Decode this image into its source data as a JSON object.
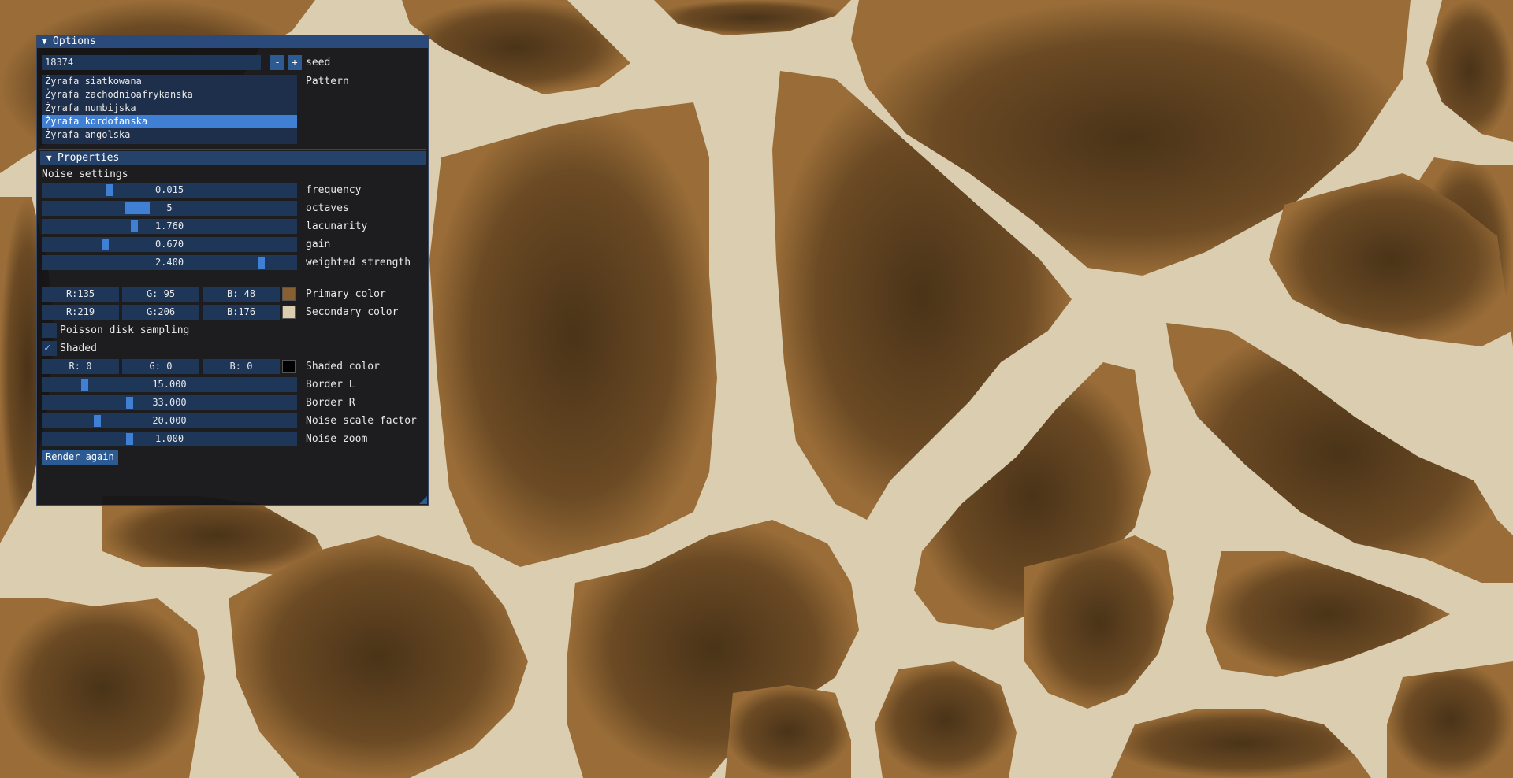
{
  "colors": {
    "primary": "#875f30",
    "secondary": "#dbceb0",
    "accent": "#3f7fd4",
    "frame": "#1e3658"
  },
  "window": {
    "title": "Options",
    "seed": {
      "value": "18374",
      "label": "seed",
      "minus": "-",
      "plus": "+"
    },
    "pattern": {
      "label": "Pattern",
      "items": [
        "Żyrafa siatkowana",
        "Żyrafa zachodnioafrykanska",
        "Żyrafa numbijska",
        "Żyrafa kordofanska",
        "Żyrafa angolska"
      ],
      "selected_index": 3
    },
    "properties": {
      "title": "Properties",
      "noise_heading": "Noise settings",
      "sliders": [
        {
          "label": "frequency",
          "value": "0.015",
          "fraction": 0.26
        },
        {
          "label": "octaves",
          "value": "5",
          "fraction": 0.36
        },
        {
          "label": "lacunarity",
          "value": "1.760",
          "fraction": 0.36
        },
        {
          "label": "gain",
          "value": "0.670",
          "fraction": 0.24
        },
        {
          "label": "weighted strength",
          "value": "2.400",
          "fraction": 0.87
        }
      ],
      "primary_color": {
        "label": "Primary color",
        "r": "R:135",
        "g": "G: 95",
        "b": "B: 48",
        "hex": "#875f30"
      },
      "secondary_color": {
        "label": "Secondary color",
        "r": "R:219",
        "g": "G:206",
        "b": "B:176",
        "hex": "#dbceb0"
      },
      "poisson": {
        "label": "Poisson disk sampling",
        "checked": false
      },
      "shaded": {
        "label": "Shaded",
        "checked": true,
        "checkmark": "✓"
      },
      "shaded_color": {
        "label": "Shaded color",
        "r": "R:  0",
        "g": "G:  0",
        "b": "B:  0",
        "hex": "#000000"
      },
      "sliders2": [
        {
          "label": "Border L",
          "value": "15.000",
          "fraction": 0.16
        },
        {
          "label": "Border R",
          "value": "33.000",
          "fraction": 0.34
        },
        {
          "label": "Noise scale factor",
          "value": "20.000",
          "fraction": 0.21
        },
        {
          "label": "Noise zoom",
          "value": "1.000",
          "fraction": 0.34
        }
      ],
      "render_button": "Render again"
    }
  }
}
